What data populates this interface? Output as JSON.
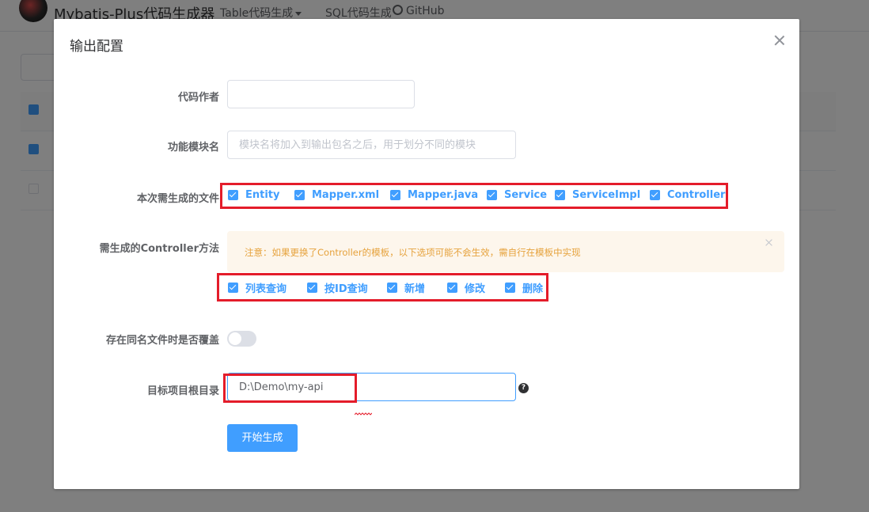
{
  "navbar": {
    "brand": "Mybatis-Plus代码生成器",
    "items": [
      {
        "label": "Table代码生成"
      },
      {
        "label": "SQL代码生成"
      },
      {
        "label": "GitHub"
      }
    ]
  },
  "dialog": {
    "title": "输出配置",
    "author_label": "代码作者",
    "author_value": "",
    "module_label": "功能模块名",
    "module_placeholder": "模块名将加入到输出包名之后，用于划分不同的模块",
    "files_label": "本次需生成的文件",
    "files": [
      {
        "label": "Entity",
        "checked": true
      },
      {
        "label": "Mapper.xml",
        "checked": true
      },
      {
        "label": "Mapper.java",
        "checked": true
      },
      {
        "label": "Service",
        "checked": true
      },
      {
        "label": "ServiceImpl",
        "checked": true
      },
      {
        "label": "Controller",
        "checked": true
      }
    ],
    "controller_label": "需生成的Controller方法",
    "controller_alert": "注意：如果更换了Controller的模板，以下选项可能不会生效，需自行在模板中实现",
    "controller_methods": [
      {
        "label": "列表查询",
        "checked": true
      },
      {
        "label": "按ID查询",
        "checked": true
      },
      {
        "label": "新增",
        "checked": true
      },
      {
        "label": "修改",
        "checked": true
      },
      {
        "label": "删除",
        "checked": true
      }
    ],
    "overwrite_label": "存在同名文件时是否覆盖",
    "overwrite_enabled": false,
    "root_label": "目标项目根目录",
    "root_value": "D:\\Demo\\my-api",
    "help_icon": "?",
    "submit_label": "开始生成"
  },
  "colors": {
    "primary": "#409eff",
    "highlight": "#e41c2a",
    "warning": "#e6a23c"
  }
}
